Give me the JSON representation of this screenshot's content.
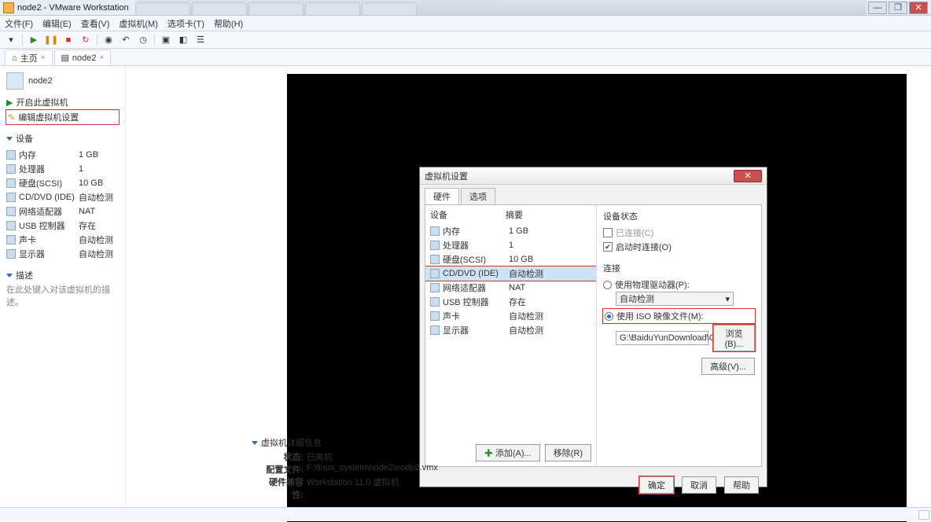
{
  "window": {
    "title": "node2 - VMware Workstation"
  },
  "winctl": {
    "min": "—",
    "max": "❐",
    "close": "✕"
  },
  "menus": [
    "文件(F)",
    "编辑(E)",
    "查看(V)",
    "虚拟机(M)",
    "选项卡(T)",
    "帮助(H)"
  ],
  "doctabs": {
    "home": "主页",
    "vm": "node2",
    "close": "×"
  },
  "vm": {
    "name": "node2",
    "links": {
      "power": "开启此虚拟机",
      "edit": "编辑虚拟机设置"
    },
    "sections": {
      "devices": "设备",
      "desc": "描述"
    },
    "devices": [
      {
        "n": "内存",
        "v": "1 GB"
      },
      {
        "n": "处理器",
        "v": "1"
      },
      {
        "n": "硬盘(SCSI)",
        "v": "10 GB"
      },
      {
        "n": "CD/DVD (IDE)",
        "v": "自动检测"
      },
      {
        "n": "网络适配器",
        "v": "NAT"
      },
      {
        "n": "USB 控制器",
        "v": "存在"
      },
      {
        "n": "声卡",
        "v": "自动检测"
      },
      {
        "n": "显示器",
        "v": "自动检测"
      }
    ],
    "desc_hint": "在此处键入对该虚拟机的描述。"
  },
  "dlg": {
    "title": "虚拟机设置",
    "tabs": {
      "hw": "硬件",
      "opt": "选项"
    },
    "cols": {
      "dev": "设备",
      "sum": "摘要"
    },
    "rows": [
      {
        "n": "内存",
        "v": "1 GB"
      },
      {
        "n": "处理器",
        "v": "1"
      },
      {
        "n": "硬盘(SCSI)",
        "v": "10 GB"
      },
      {
        "n": "CD/DVD (IDE)",
        "v": "自动检测"
      },
      {
        "n": "网络适配器",
        "v": "NAT"
      },
      {
        "n": "USB 控制器",
        "v": "存在"
      },
      {
        "n": "声卡",
        "v": "自动检测"
      },
      {
        "n": "显示器",
        "v": "自动检测"
      }
    ],
    "add": "添加(A)...",
    "remove": "移除(R)",
    "state": {
      "title": "设备状态",
      "connected": "已连接(C)",
      "poweron": "启动时连接(O)"
    },
    "conn": {
      "title": "连接",
      "phys": "使用物理驱动器(P):",
      "auto": "自动检测",
      "iso": "使用 ISO 映像文件(M):",
      "path": "G:\\BaiduYunDownload\\Cent",
      "browse": "浏览(B)...",
      "adv": "高级(V)..."
    },
    "btns": {
      "ok": "确定",
      "cancel": "取消",
      "help": "帮助"
    }
  },
  "details": {
    "title": "虚拟机详细信息",
    "rows": [
      {
        "l": "状态:",
        "v": "已关机"
      },
      {
        "l": "配置文件:",
        "v": "F:\\linux_system\\node2\\node2.vmx"
      },
      {
        "l": "硬件兼容性:",
        "v": "Workstation 11.0 虚拟机"
      }
    ]
  }
}
